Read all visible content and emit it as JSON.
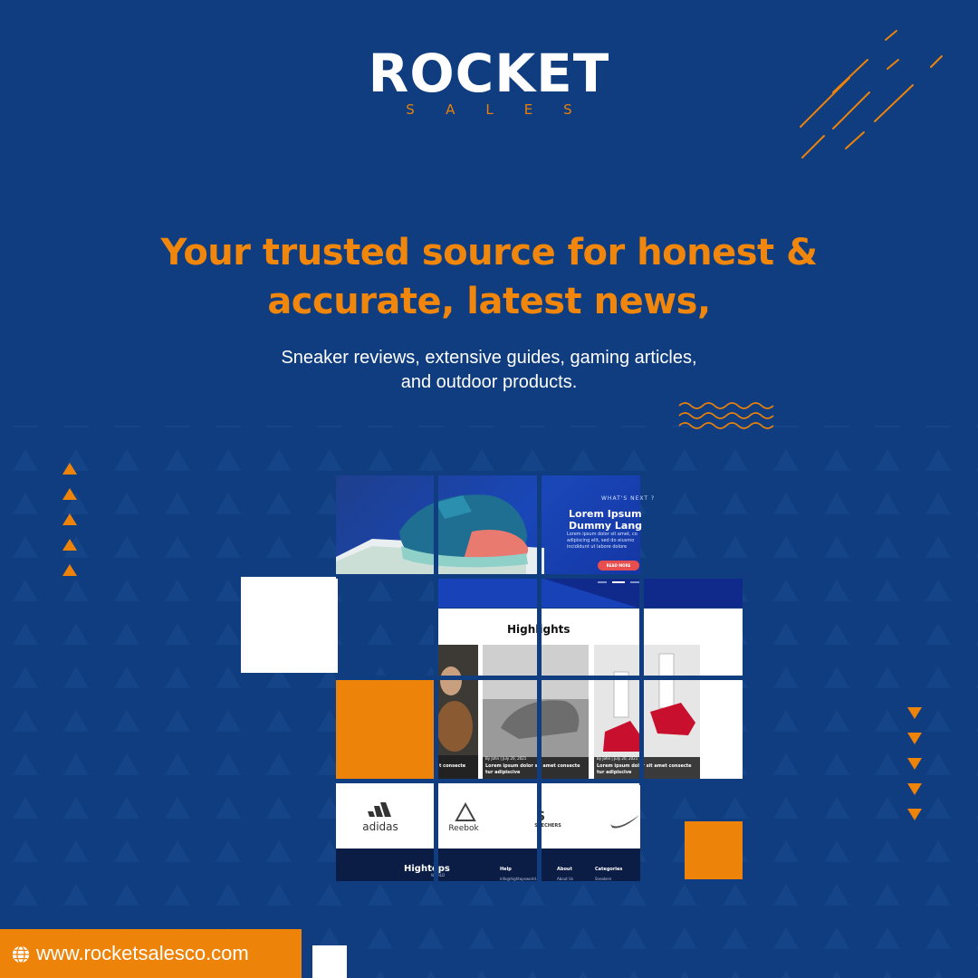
{
  "brand": {
    "name": "ROCKET",
    "tagline": "SALES"
  },
  "headline": {
    "line1": "Your trusted source for honest &",
    "line2": "accurate, latest news,"
  },
  "subheadline": {
    "line1": "Sneaker reviews, extensive guides, gaming articles,",
    "line2": "and outdoor products."
  },
  "mockup": {
    "hero": {
      "kicker": "WHAT'S NEXT ?",
      "title": "Lorem Ipsum Dummy Lang",
      "text": "Lorem ipsum dolor sit amet, co adipiscing elit, sed do eiusmo incididunt ut labore dolore",
      "button": "READ MORE"
    },
    "highlights_title": "Highlights",
    "cards": [
      {
        "caption": "t consecte"
      },
      {
        "meta": "By John | July 20, 2021",
        "caption": "Lorem ipsum dolor sit amet consecte tur adipiscive"
      },
      {
        "meta": "By John | July 20, 2021",
        "caption": "Lorem ipsum dolor sit amet consecte tur adipiscive"
      }
    ],
    "brands": [
      "adidas",
      "Reebok",
      "SKECHERS",
      "nike-swoosh"
    ],
    "footer": {
      "logo": "Hightops",
      "logo_sub": "WORLD",
      "cols": [
        {
          "title": "Help",
          "item": "info@hightopsworld.co"
        },
        {
          "title": "About",
          "item": "About Us"
        },
        {
          "title": "Categories",
          "item": "Sneakers"
        }
      ]
    }
  },
  "url": "www.rocketsalesco.com",
  "icons": {
    "globe": "globe-icon"
  },
  "colors": {
    "background": "#0f3d80",
    "accent": "#ee8309",
    "white": "#ffffff"
  }
}
